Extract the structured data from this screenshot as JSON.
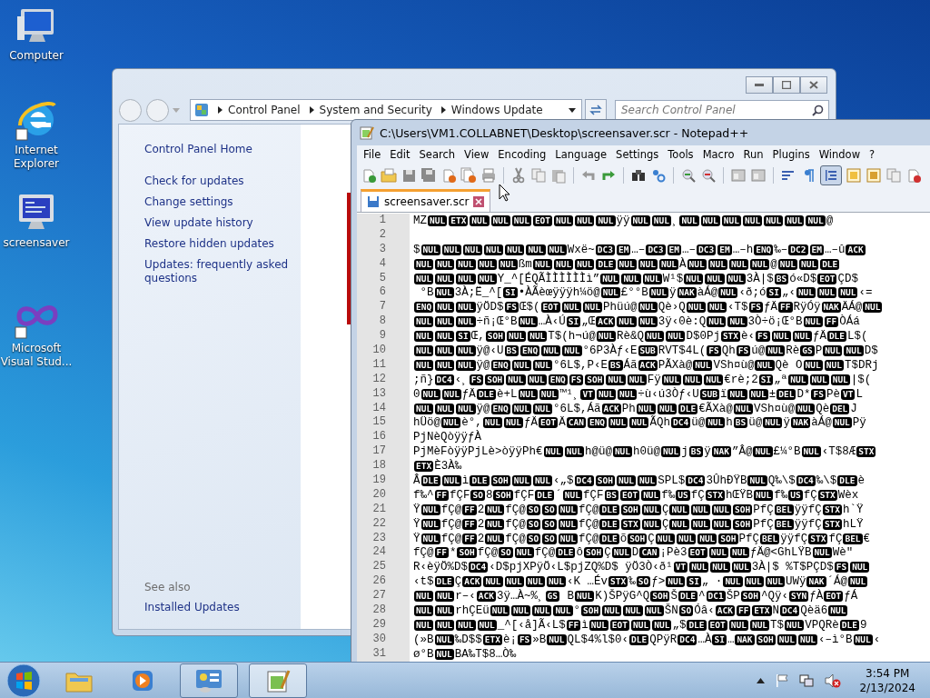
{
  "desktop_icons": [
    {
      "label": "Computer",
      "kind": "computer"
    },
    {
      "label": "Internet Explorer",
      "kind": "browser"
    },
    {
      "label": "screensaver",
      "kind": "screensaver"
    },
    {
      "label": "Microsoft Visual Stud...",
      "kind": "studio"
    }
  ],
  "control_panel": {
    "breadcrumb": [
      "Control Panel",
      "System and Security",
      "Windows Update"
    ],
    "search": {
      "placeholder": "Search Control Panel"
    },
    "links": [
      "Control Panel Home",
      "Check for updates",
      "Change settings",
      "View update history",
      "Restore hidden updates",
      "Updates: frequently asked questions"
    ],
    "see_also": {
      "heading": "See also",
      "links": [
        "Installed Updates"
      ]
    }
  },
  "notepad": {
    "title": "C:\\Users\\VM1.COLLABNET\\Desktop\\screensaver.scr - Notepad++",
    "menu": [
      "File",
      "Edit",
      "Search",
      "View",
      "Encoding",
      "Language",
      "Settings",
      "Tools",
      "Macro",
      "Run",
      "Plugins",
      "Window",
      "?"
    ],
    "toolbar": {
      "indent_guide_pressed": true
    },
    "tabs": [
      {
        "label": "screensaver.scr",
        "selected": true
      }
    ],
    "lines": [
      {
        "number": "1",
        "segments": [
          {
            "text": "MZ"
          },
          {
            "code": "NUL"
          },
          {
            "code": "ETX"
          },
          {
            "code": "NUL"
          },
          {
            "code": "NUL"
          },
          {
            "code": "NUL"
          },
          {
            "code": "EOT"
          },
          {
            "code": "NUL"
          },
          {
            "code": "NUL"
          },
          {
            "code": "NUL"
          },
          {
            "text": "ÿÿ"
          },
          {
            "code": "NUL"
          },
          {
            "code": "NUL"
          },
          {
            "text": "¸"
          },
          {
            "code": "NUL"
          },
          {
            "code": "NUL"
          },
          {
            "code": "NUL"
          },
          {
            "code": "NUL"
          },
          {
            "code": "NUL"
          },
          {
            "code": "NUL"
          },
          {
            "code": "NUL"
          },
          {
            "text": "@"
          }
        ]
      },
      {
        "number": "2"
      },
      {
        "number": "3",
        "segments": [
          {
            "text": "$"
          },
          {
            "code": "NUL"
          },
          {
            "code": "NUL"
          },
          {
            "code": "NUL"
          },
          {
            "code": "NUL"
          },
          {
            "code": "NUL"
          },
          {
            "code": "NUL"
          },
          {
            "code": "NUL"
          },
          {
            "text": "Wxë~"
          },
          {
            "code": "DC3"
          },
          {
            "code": "EM"
          },
          {
            "text": "…–"
          },
          {
            "code": "DC3"
          },
          {
            "code": "EM"
          },
          {
            "text": "…–"
          },
          {
            "code": "DC3"
          },
          {
            "code": "EM"
          },
          {
            "text": "…–h"
          },
          {
            "code": "ENQ"
          },
          {
            "text": "‰–"
          },
          {
            "code": "DC2"
          },
          {
            "code": "EM"
          },
          {
            "text": "…–û"
          },
          {
            "code": "ACK"
          }
        ]
      },
      {
        "number": "4",
        "segments": [
          {
            "code": "NUL"
          },
          {
            "code": "NUL"
          },
          {
            "code": "NUL"
          },
          {
            "code": "NUL"
          },
          {
            "code": "NUL"
          },
          {
            "text": "ßm"
          },
          {
            "code": "NUL"
          },
          {
            "code": "NUL"
          },
          {
            "code": "NUL"
          },
          {
            "code": "DLE"
          },
          {
            "code": "NUL"
          },
          {
            "code": "NUL"
          },
          {
            "code": "NUL"
          },
          {
            "text": "À"
          },
          {
            "code": "NUL"
          },
          {
            "code": "NUL"
          },
          {
            "code": "NUL"
          },
          {
            "code": "NUL"
          },
          {
            "text": "@"
          },
          {
            "code": "NUL"
          },
          {
            "code": "NUL"
          },
          {
            "code": "DLE"
          }
        ]
      },
      {
        "number": "5",
        "segments": [
          {
            "code": "NUL"
          },
          {
            "code": "NUL"
          },
          {
            "code": "NUL"
          },
          {
            "code": "NUL"
          },
          {
            "text": "Y_^[ÉQÃÌÌÌÌÌÌì”"
          },
          {
            "code": "NUL"
          },
          {
            "code": "NUL"
          },
          {
            "code": "NUL"
          },
          {
            "text": "W¹$"
          },
          {
            "code": "NUL"
          },
          {
            "code": "NUL"
          },
          {
            "code": "NUL"
          },
          {
            "text": "3À|$"
          },
          {
            "code": "BS"
          },
          {
            "text": "ó«D$"
          },
          {
            "code": "EOT"
          },
          {
            "text": "ÇD$"
          }
        ]
      },
      {
        "number": "6",
        "segments": [
          {
            "text": " °B"
          },
          {
            "code": "NUL"
          },
          {
            "text": "3À;Ë_^["
          },
          {
            "code": "SI"
          },
          {
            "text": "•ÀÃèœÿÿÿh¼ö@"
          },
          {
            "code": "NUL"
          },
          {
            "text": "£°°B"
          },
          {
            "code": "NUL"
          },
          {
            "text": "ÿ"
          },
          {
            "code": "NAK"
          },
          {
            "text": "àÁ@"
          },
          {
            "code": "NUL"
          },
          {
            "text": "‹ð;ó"
          },
          {
            "code": "SI"
          },
          {
            "text": "„‹"
          },
          {
            "code": "NUL"
          },
          {
            "code": "NUL"
          },
          {
            "code": "NUL"
          },
          {
            "text": "‹="
          }
        ]
      },
      {
        "number": "7",
        "segments": [
          {
            "code": "ENQ"
          },
          {
            "code": "NUL"
          },
          {
            "code": "NUL"
          },
          {
            "text": "ÿÖD$"
          },
          {
            "code": "FS"
          },
          {
            "text": "Œ$("
          },
          {
            "code": "EOT"
          },
          {
            "code": "NUL"
          },
          {
            "code": "NUL"
          },
          {
            "text": "Phüú@"
          },
          {
            "code": "NUL"
          },
          {
            "text": "Qè›Q"
          },
          {
            "code": "NUL"
          },
          {
            "code": "NUL"
          },
          {
            "text": "‹T$"
          },
          {
            "code": "FS"
          },
          {
            "text": "ƒÄ"
          },
          {
            "code": "FF"
          },
          {
            "text": "RÿÓÿ"
          },
          {
            "code": "NAK"
          },
          {
            "text": "ÄÁ@"
          },
          {
            "code": "NUL"
          }
        ]
      },
      {
        "number": "8",
        "segments": [
          {
            "code": "NUL"
          },
          {
            "code": "NUL"
          },
          {
            "code": "NUL"
          },
          {
            "text": "÷ñ¡Œ°B"
          },
          {
            "code": "NUL"
          },
          {
            "text": "…À‹Ú"
          },
          {
            "code": "SI"
          },
          {
            "text": "„Œ"
          },
          {
            "code": "ACK"
          },
          {
            "code": "NUL"
          },
          {
            "code": "NUL"
          },
          {
            "text": "3ÿ‹0è:Q"
          },
          {
            "code": "NUL"
          },
          {
            "code": "NUL"
          },
          {
            "text": "3Ò÷ö¡Œ°B"
          },
          {
            "code": "NUL"
          },
          {
            "code": "FF"
          },
          {
            "text": "ÒÁá"
          }
        ]
      },
      {
        "number": "9",
        "segments": [
          {
            "code": "NUL"
          },
          {
            "code": "NUL"
          },
          {
            "code": "SI"
          },
          {
            "text": "Œ,"
          },
          {
            "code": "SOH"
          },
          {
            "code": "NUL"
          },
          {
            "code": "NUL"
          },
          {
            "text": "T$(h¬ú@"
          },
          {
            "code": "NUL"
          },
          {
            "text": "Rè&Q"
          },
          {
            "code": "NUL"
          },
          {
            "code": "NUL"
          },
          {
            "text": "D$0Pj"
          },
          {
            "code": "STX"
          },
          {
            "text": "è‹"
          },
          {
            "code": "FS"
          },
          {
            "code": "NUL"
          },
          {
            "code": "NUL"
          },
          {
            "text": "ƒÄ"
          },
          {
            "code": "DLE"
          },
          {
            "text": "L$("
          }
        ]
      },
      {
        "number": "10",
        "segments": [
          {
            "code": "NUL"
          },
          {
            "code": "NUL"
          },
          {
            "code": "NUL"
          },
          {
            "text": "ÿ@‹U"
          },
          {
            "code": "BS"
          },
          {
            "code": "ENQ"
          },
          {
            "code": "NUL"
          },
          {
            "code": "NUL"
          },
          {
            "text": "°6P3Àƒ‹E"
          },
          {
            "code": "SUB"
          },
          {
            "text": "RVT$4L("
          },
          {
            "code": "FS"
          },
          {
            "text": "Qh"
          },
          {
            "code": "FS"
          },
          {
            "text": "ú@"
          },
          {
            "code": "NUL"
          },
          {
            "text": "Rè"
          },
          {
            "code": "GS"
          },
          {
            "text": "P"
          },
          {
            "code": "NUL"
          },
          {
            "code": "NUL"
          },
          {
            "text": "D$"
          }
        ]
      },
      {
        "number": "11",
        "segments": [
          {
            "code": "NUL"
          },
          {
            "code": "NUL"
          },
          {
            "code": "NUL"
          },
          {
            "text": "ÿ@"
          },
          {
            "code": "ENQ"
          },
          {
            "code": "NUL"
          },
          {
            "code": "NUL"
          },
          {
            "text": "°6L$,P‹E"
          },
          {
            "code": "BS"
          },
          {
            "text": "Áã"
          },
          {
            "code": "ACK"
          },
          {
            "text": "PÃXà@"
          },
          {
            "code": "NUL"
          },
          {
            "text": "VSh¤ù@"
          },
          {
            "code": "NUL"
          },
          {
            "text": "Qè O"
          },
          {
            "code": "NUL"
          },
          {
            "code": "NUL"
          },
          {
            "text": "T$DRj"
          }
        ]
      },
      {
        "number": "12",
        "segments": [
          {
            "text": ";ñ}"
          },
          {
            "code": "DC4"
          },
          {
            "text": "‹¸"
          },
          {
            "code": "FS"
          },
          {
            "code": "SOH"
          },
          {
            "code": "NUL"
          },
          {
            "code": "NUL"
          },
          {
            "code": "ENQ"
          },
          {
            "code": "FS"
          },
          {
            "code": "SOH"
          },
          {
            "code": "NUL"
          },
          {
            "code": "NUL"
          },
          {
            "text": "Fÿ"
          },
          {
            "code": "NUL"
          },
          {
            "code": "NUL"
          },
          {
            "code": "NUL"
          },
          {
            "text": "€rè;2"
          },
          {
            "code": "SI"
          },
          {
            "text": "„ª"
          },
          {
            "code": "NUL"
          },
          {
            "code": "NUL"
          },
          {
            "code": "NUL"
          },
          {
            "text": "|$("
          }
        ]
      },
      {
        "number": "13",
        "segments": [
          {
            "text": "0"
          },
          {
            "code": "NUL"
          },
          {
            "code": "NUL"
          },
          {
            "text": "ƒÄ"
          },
          {
            "code": "DLE"
          },
          {
            "text": "è+L"
          },
          {
            "code": "NUL"
          },
          {
            "code": "NUL"
          },
          {
            "text": "™¹¸"
          },
          {
            "code": "VT"
          },
          {
            "code": "NUL"
          },
          {
            "code": "NUL"
          },
          {
            "text": "÷ù‹ú3Òƒ‹U"
          },
          {
            "code": "SUB"
          },
          {
            "text": "ï"
          },
          {
            "code": "NUL"
          },
          {
            "code": "NUL"
          },
          {
            "text": "±"
          },
          {
            "code": "DEL"
          },
          {
            "text": "D*"
          },
          {
            "code": "FS"
          },
          {
            "text": "Pè"
          },
          {
            "code": "VT"
          },
          {
            "text": "L"
          }
        ]
      },
      {
        "number": "14",
        "segments": [
          {
            "code": "NUL"
          },
          {
            "code": "NUL"
          },
          {
            "code": "NUL"
          },
          {
            "text": "ÿ@"
          },
          {
            "code": "ENQ"
          },
          {
            "code": "NUL"
          },
          {
            "code": "NUL"
          },
          {
            "text": "°6L$,Áã"
          },
          {
            "code": "ACK"
          },
          {
            "text": "Ph"
          },
          {
            "code": "NUL"
          },
          {
            "code": "NUL"
          },
          {
            "code": "DLE"
          },
          {
            "text": "€ÃXà@"
          },
          {
            "code": "NUL"
          },
          {
            "text": "VSh¤ù@"
          },
          {
            "code": "NUL"
          },
          {
            "text": "Qè"
          },
          {
            "code": "DEL"
          },
          {
            "text": "J"
          }
        ]
      },
      {
        "number": "15",
        "segments": [
          {
            "text": "hÜö@"
          },
          {
            "code": "NUL"
          },
          {
            "text": "è°,"
          },
          {
            "code": "NUL"
          },
          {
            "code": "NUL"
          },
          {
            "text": "ƒÄ"
          },
          {
            "code": "EOT"
          },
          {
            "text": "Ä"
          },
          {
            "code": "CAN"
          },
          {
            "code": "ENQ"
          },
          {
            "code": "NUL"
          },
          {
            "code": "NUL"
          },
          {
            "text": "ÃQh"
          },
          {
            "code": "DC4"
          },
          {
            "text": "ü@"
          },
          {
            "code": "NUL"
          },
          {
            "text": "h"
          },
          {
            "code": "BS"
          },
          {
            "text": "ü@"
          },
          {
            "code": "NUL"
          },
          {
            "text": "ÿ"
          },
          {
            "code": "NAK"
          },
          {
            "text": "àÁ@"
          },
          {
            "code": "NUL"
          },
          {
            "text": "Pÿ"
          }
        ]
      },
      {
        "number": "16",
        "segments": [
          {
            "text": "PjNèQòÿÿƒÀ"
          }
        ]
      },
      {
        "number": "17",
        "segments": [
          {
            "text": "PjMèFòÿÿPjLè>òÿÿPh€"
          },
          {
            "code": "NUL"
          },
          {
            "code": "NUL"
          },
          {
            "text": "h@ü@"
          },
          {
            "code": "NUL"
          },
          {
            "text": "h0ü@"
          },
          {
            "code": "NUL"
          },
          {
            "text": "j"
          },
          {
            "code": "BS"
          },
          {
            "text": "ÿ"
          },
          {
            "code": "NAK"
          },
          {
            "text": "”Â@"
          },
          {
            "code": "NUL"
          },
          {
            "text": "£¼°B"
          },
          {
            "code": "NUL"
          },
          {
            "text": "‹T$8Æ"
          },
          {
            "code": "STX"
          }
        ]
      },
      {
        "number": "18",
        "segments": [
          {
            "code": "ETX"
          },
          {
            "text": "È3À‰"
          }
        ]
      },
      {
        "number": "19",
        "segments": [
          {
            "text": "Â"
          },
          {
            "code": "DLE"
          },
          {
            "code": "NUL"
          },
          {
            "text": "ì"
          },
          {
            "code": "DLE"
          },
          {
            "code": "SOH"
          },
          {
            "code": "NUL"
          },
          {
            "code": "NUL"
          },
          {
            "text": "‹„$"
          },
          {
            "code": "DC4"
          },
          {
            "code": "SOH"
          },
          {
            "code": "NUL"
          },
          {
            "code": "NUL"
          },
          {
            "text": "SPL$"
          },
          {
            "code": "DC4"
          },
          {
            "text": "3ÛhÐŸB"
          },
          {
            "code": "NUL"
          },
          {
            "text": "Q‰\\$"
          },
          {
            "code": "DC4"
          },
          {
            "text": "‰\\$"
          },
          {
            "code": "DLE"
          },
          {
            "text": "è"
          }
        ]
      },
      {
        "number": "20",
        "segments": [
          {
            "text": "f‰^"
          },
          {
            "code": "FF"
          },
          {
            "text": "fÇF"
          },
          {
            "code": "SO"
          },
          {
            "text": "8"
          },
          {
            "code": "SOH"
          },
          {
            "text": "fÇF"
          },
          {
            "code": "DLE"
          },
          {
            "text": "´"
          },
          {
            "code": "NUL"
          },
          {
            "text": "fÇF"
          },
          {
            "code": "BS"
          },
          {
            "code": "EOT"
          },
          {
            "code": "NUL"
          },
          {
            "text": "f‰"
          },
          {
            "code": "US"
          },
          {
            "text": "fÇ"
          },
          {
            "code": "STX"
          },
          {
            "text": "hŒŸB"
          },
          {
            "code": "NUL"
          },
          {
            "text": "f‰"
          },
          {
            "code": "US"
          },
          {
            "text": "fÇ"
          },
          {
            "code": "STX"
          },
          {
            "text": "Wèx"
          }
        ]
      },
      {
        "number": "21",
        "segments": [
          {
            "text": "Ÿ"
          },
          {
            "code": "NUL"
          },
          {
            "text": "fÇ@"
          },
          {
            "code": "FF"
          },
          {
            "text": "2"
          },
          {
            "code": "NUL"
          },
          {
            "text": "fÇ@"
          },
          {
            "code": "SO"
          },
          {
            "code": "SO"
          },
          {
            "code": "NUL"
          },
          {
            "text": "fÇ@"
          },
          {
            "code": "DLE"
          },
          {
            "code": "SOH"
          },
          {
            "code": "NUL"
          },
          {
            "text": "Ç"
          },
          {
            "code": "NUL"
          },
          {
            "code": "NUL"
          },
          {
            "code": "NUL"
          },
          {
            "code": "SOH"
          },
          {
            "text": "PfÇ"
          },
          {
            "code": "BEL"
          },
          {
            "text": "ÿÿfÇ"
          },
          {
            "code": "STX"
          },
          {
            "text": "h`Ÿ"
          }
        ]
      },
      {
        "number": "22",
        "segments": [
          {
            "text": "Ÿ"
          },
          {
            "code": "NUL"
          },
          {
            "text": "fÇ@"
          },
          {
            "code": "FF"
          },
          {
            "text": "2"
          },
          {
            "code": "NUL"
          },
          {
            "text": "fÇ@"
          },
          {
            "code": "SO"
          },
          {
            "code": "SO"
          },
          {
            "code": "NUL"
          },
          {
            "text": "fÇ@"
          },
          {
            "code": "DLE"
          },
          {
            "code": "STX"
          },
          {
            "code": "NUL"
          },
          {
            "text": "Ç"
          },
          {
            "code": "NUL"
          },
          {
            "code": "NUL"
          },
          {
            "code": "NUL"
          },
          {
            "code": "SOH"
          },
          {
            "text": "PfÇ"
          },
          {
            "code": "BEL"
          },
          {
            "text": "ÿÿfÇ"
          },
          {
            "code": "STX"
          },
          {
            "text": "hLŸ"
          }
        ]
      },
      {
        "number": "23",
        "segments": [
          {
            "text": "Ÿ"
          },
          {
            "code": "NUL"
          },
          {
            "text": "fÇ@"
          },
          {
            "code": "FF"
          },
          {
            "text": "2"
          },
          {
            "code": "NUL"
          },
          {
            "text": "fÇ@"
          },
          {
            "code": "SO"
          },
          {
            "code": "SO"
          },
          {
            "code": "NUL"
          },
          {
            "text": "fÇ@"
          },
          {
            "code": "DLE"
          },
          {
            "text": "õ"
          },
          {
            "code": "SOH"
          },
          {
            "text": "Ç"
          },
          {
            "code": "NUL"
          },
          {
            "code": "NUL"
          },
          {
            "code": "NUL"
          },
          {
            "code": "SOH"
          },
          {
            "text": "PfÇ"
          },
          {
            "code": "BEL"
          },
          {
            "text": "ÿÿfÇ"
          },
          {
            "code": "STX"
          },
          {
            "text": "fÇ"
          },
          {
            "code": "BEL"
          },
          {
            "text": "€"
          }
        ]
      },
      {
        "number": "24",
        "segments": [
          {
            "text": "fÇ@"
          },
          {
            "code": "FF"
          },
          {
            "text": "*"
          },
          {
            "code": "SOH"
          },
          {
            "text": "fÇ@"
          },
          {
            "code": "SO"
          },
          {
            "code": "NUL"
          },
          {
            "text": "fÇ@"
          },
          {
            "code": "DLE"
          },
          {
            "text": "ô"
          },
          {
            "code": "SOH"
          },
          {
            "text": "Ç"
          },
          {
            "code": "NUL"
          },
          {
            "text": "D"
          },
          {
            "code": "CAN"
          },
          {
            "text": "¡Pè3"
          },
          {
            "code": "EOT"
          },
          {
            "code": "NUL"
          },
          {
            "code": "NUL"
          },
          {
            "text": "ƒÄ@<GhLŸB"
          },
          {
            "code": "NUL"
          },
          {
            "text": "Wè\""
          }
        ]
      },
      {
        "number": "25",
        "segments": [
          {
            "text": "R‹èÿÖ%D$"
          },
          {
            "code": "DC4"
          },
          {
            "text": "‹D$pjXPÿÖ‹L$pjZQ%D$ ÿÖ3Ò‹ð¹"
          },
          {
            "code": "VT"
          },
          {
            "code": "NUL"
          },
          {
            "code": "NUL"
          },
          {
            "code": "NUL"
          },
          {
            "text": "3À|$ %T$PÇD$"
          },
          {
            "code": "FS"
          },
          {
            "code": "NUL"
          }
        ]
      },
      {
        "number": "26",
        "segments": [
          {
            "text": "‹t$"
          },
          {
            "code": "DLE"
          },
          {
            "text": "Ç"
          },
          {
            "code": "ACK"
          },
          {
            "code": "NUL"
          },
          {
            "code": "NUL"
          },
          {
            "code": "NUL"
          },
          {
            "code": "NUL"
          },
          {
            "text": "‹K …Év"
          },
          {
            "code": "STX"
          },
          {
            "text": "‰"
          },
          {
            "code": "SO"
          },
          {
            "text": "ƒ>"
          },
          {
            "code": "NUL"
          },
          {
            "code": "SI"
          },
          {
            "text": "„ ·"
          },
          {
            "code": "NUL"
          },
          {
            "code": "NUL"
          },
          {
            "code": "NUL"
          },
          {
            "text": "UWÿ"
          },
          {
            "code": "NAK"
          },
          {
            "text": "´Á@"
          },
          {
            "code": "NUL"
          }
        ]
      },
      {
        "number": "27",
        "segments": [
          {
            "code": "NUL"
          },
          {
            "code": "NUL"
          },
          {
            "text": "r–‹"
          },
          {
            "code": "ACK"
          },
          {
            "text": "3ÿ…À~%¸"
          },
          {
            "code": "GS"
          },
          {
            "text": " B"
          },
          {
            "code": "NUL"
          },
          {
            "text": "K)ŠPÿG^Q"
          },
          {
            "code": "SOH"
          },
          {
            "text": "Š"
          },
          {
            "code": "DLE"
          },
          {
            "text": "^"
          },
          {
            "code": "DC1"
          },
          {
            "text": "ŠP"
          },
          {
            "code": "SOH"
          },
          {
            "text": "^Qÿ‹"
          },
          {
            "code": "SYN"
          },
          {
            "text": "ƒÀ"
          },
          {
            "code": "EOT"
          },
          {
            "text": "ƒÁ"
          }
        ]
      },
      {
        "number": "28",
        "segments": [
          {
            "code": "NUL"
          },
          {
            "code": "NUL"
          },
          {
            "text": "rhÇEü"
          },
          {
            "code": "NUL"
          },
          {
            "code": "NUL"
          },
          {
            "code": "NUL"
          },
          {
            "code": "NUL"
          },
          {
            "text": "°"
          },
          {
            "code": "SOH"
          },
          {
            "code": "NUL"
          },
          {
            "code": "NUL"
          },
          {
            "code": "NUL"
          },
          {
            "text": "ŠN"
          },
          {
            "code": "SO"
          },
          {
            "text": "Óâ‹"
          },
          {
            "code": "ACK"
          },
          {
            "code": "FF"
          },
          {
            "code": "ETX"
          },
          {
            "text": "N"
          },
          {
            "code": "DC4"
          },
          {
            "text": "Qèä6"
          },
          {
            "code": "NUL"
          }
        ]
      },
      {
        "number": "29",
        "segments": [
          {
            "code": "NUL"
          },
          {
            "code": "NUL"
          },
          {
            "code": "NUL"
          },
          {
            "code": "NUL"
          },
          {
            "text": "_^[‹å]Ã"
          },
          {
            "text": "‹L$"
          },
          {
            "code": "FF"
          },
          {
            "text": "ì"
          },
          {
            "code": "NUL"
          },
          {
            "code": "EOT"
          },
          {
            "code": "NUL"
          },
          {
            "code": "NUL"
          },
          {
            "text": "„$"
          },
          {
            "code": "DLE"
          },
          {
            "code": "EOT"
          },
          {
            "code": "NUL"
          },
          {
            "code": "NUL"
          },
          {
            "text": "T$"
          },
          {
            "code": "NUL"
          },
          {
            "text": "VPQRè"
          },
          {
            "code": "DLE"
          },
          {
            "text": "9"
          }
        ]
      },
      {
        "number": "30",
        "segments": [
          {
            "text": "(»B"
          },
          {
            "code": "NUL"
          },
          {
            "text": "‰D$$"
          },
          {
            "code": "ETX"
          },
          {
            "text": "è¡"
          },
          {
            "code": "FS"
          },
          {
            "text": "»B"
          },
          {
            "code": "NUL"
          },
          {
            "text": "QL$4%l$0‹"
          },
          {
            "code": "DLE"
          },
          {
            "text": "QPÿR"
          },
          {
            "code": "DC4"
          },
          {
            "text": "…À"
          },
          {
            "code": "SI"
          },
          {
            "text": "…"
          },
          {
            "code": "NAK"
          },
          {
            "code": "SOH"
          },
          {
            "code": "NUL"
          },
          {
            "code": "NUL"
          },
          {
            "text": "‹–ì°B"
          },
          {
            "code": "NUL"
          },
          {
            "text": "‹"
          }
        ]
      },
      {
        "number": "31",
        "segments": [
          {
            "text": "ø°B"
          },
          {
            "code": "NUL"
          },
          {
            "text": "BA‰T$8…Ò‰"
          }
        ]
      }
    ]
  },
  "taskbar": {
    "buttons": [
      {
        "kind": "explorer",
        "selected": false
      },
      {
        "kind": "media",
        "selected": false
      },
      {
        "kind": "control_panel",
        "selected": false
      },
      {
        "kind": "notepad",
        "selected": true
      }
    ],
    "volume_muted": true,
    "time": "3:54 PM",
    "date": "2/13/2024"
  }
}
